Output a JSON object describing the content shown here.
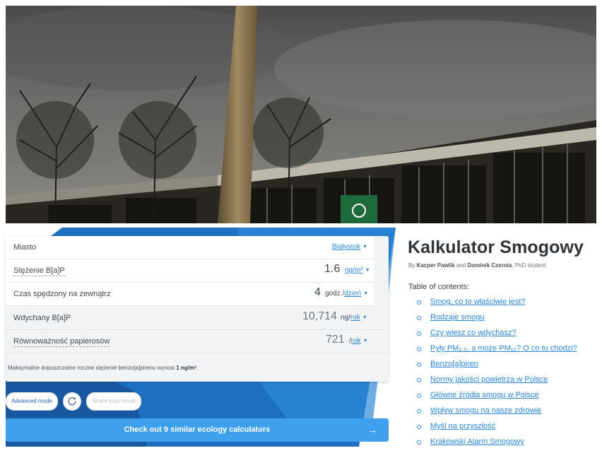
{
  "calculator": {
    "rows": [
      {
        "label": "Miasto",
        "value": "",
        "unit_prefix": "",
        "unit_link": "Białystok"
      },
      {
        "label": "Stężenie B[a]P",
        "value": "1.6",
        "unit_prefix": "",
        "unit_link": "ng/m³"
      },
      {
        "label": "Czas spędzony na zewnątrz",
        "value": "4",
        "unit_prefix": "godz./",
        "unit_link": "dzień"
      },
      {
        "label": "Wdychany B[a]P",
        "value": "10,714",
        "unit_prefix": "ng/",
        "unit_link": "rok"
      },
      {
        "label": "Równoważność papierosów",
        "value": "721",
        "unit_prefix": "/",
        "unit_link": "rok"
      }
    ],
    "note_prefix": "Maksymalne dopuszczalne roczne stężenie benzo[a]pirenu wynosi ",
    "note_bold": "1 ng/m³",
    "note_suffix": ".",
    "caret": "▼"
  },
  "actions": {
    "advanced_mode": "Advanced mode",
    "share": "Share your result",
    "refresh_icon": "refresh-icon"
  },
  "cta": {
    "label": "Check out 9 similar ecology calculators",
    "arrow": "→"
  },
  "article": {
    "title": "Kalkulator Smogowy",
    "by": "By ",
    "author1": "Kacper Pawlik",
    "and": " and ",
    "author2": "Dominik Czernia",
    "suffix": ", PhD student",
    "toc_heading": "Table of contents:",
    "toc": [
      "Smog, co to właściwie jest?",
      "Rodzaje smogu",
      "Czy wiesz co wdychasz?",
      "Pyły PM₂.₅, a może PM₁₀? O co tu chodzi?",
      "Benzo[a]piren",
      "Normy jakości powietrza w Polsce",
      "Główne źródła smogu w Polsce",
      "Wpływ smogu na nasze zdrowie",
      "Myśl na przyszłość",
      "Krakowski Alarm Smogowy"
    ]
  },
  "colors": {
    "link": "#2a86d4",
    "cta": "#3fa0ee",
    "panel_blue": "#1d6fc0"
  }
}
